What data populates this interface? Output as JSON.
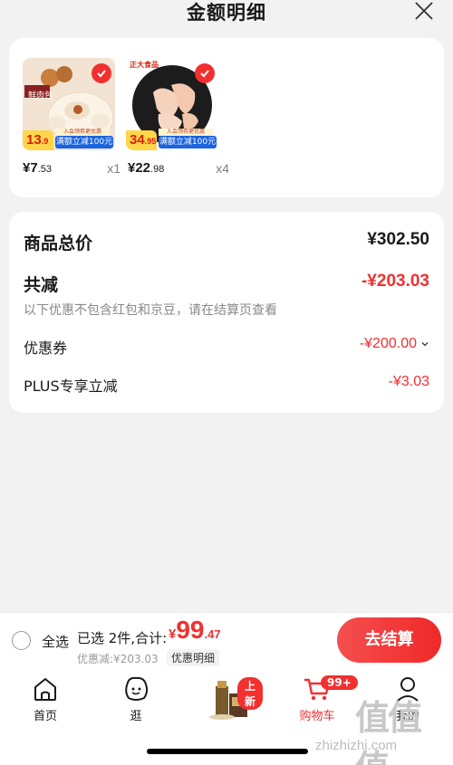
{
  "header": {
    "title": "金额明细"
  },
  "products": [
    {
      "name": "鲜肉包",
      "promo_price_int": "13",
      "promo_price_dec": ".9",
      "promo_text": "满额立减100元",
      "promo_tag": "入会领券更优惠",
      "price_int": "¥7",
      "price_dec": ".53",
      "qty": "x1"
    },
    {
      "name": "",
      "brand": "正大食品",
      "promo_price_int": "34",
      "promo_price_dec": ".95",
      "promo_text": "满额立减100元",
      "promo_tag": "入会领券更优惠",
      "price_int": "¥22",
      "price_dec": ".98",
      "qty": "x4"
    }
  ],
  "summary": {
    "total_label": "商品总价",
    "total_value": "¥302.50",
    "reduce_label": "共减",
    "reduce_value": "-¥203.03",
    "note": "以下优惠不包含红包和京豆，请在结算页查看",
    "coupon_label": "优惠券",
    "coupon_value": "-¥200.00",
    "plus_label": "PLUS专享立减",
    "plus_value": "-¥3.03"
  },
  "checkout": {
    "select_all": "全选",
    "selected_info": "已选 2件,合计:",
    "currency": "¥",
    "total_int": "99",
    "total_dec": ".47",
    "discount_line": "优惠减:¥203.03",
    "detail_link": "优惠明细",
    "pay_button": "去结算"
  },
  "tabbar": {
    "tabs": [
      {
        "label": "首页",
        "icon": "home-icon"
      },
      {
        "label": "逛",
        "icon": "browse-face-icon"
      },
      {
        "label": "",
        "icon": "promo-product-icon",
        "badge": "上新"
      },
      {
        "label": "购物车",
        "icon": "cart-icon",
        "badge": "99+"
      },
      {
        "label": "我的",
        "icon": "person-icon"
      }
    ]
  },
  "watermark": {
    "text": "zhizhizhi.com",
    "logo": "值值值"
  },
  "colors": {
    "accent": "#f23030",
    "promo_blue": "#1a63e0",
    "promo_yellow": "#ffd54a"
  }
}
